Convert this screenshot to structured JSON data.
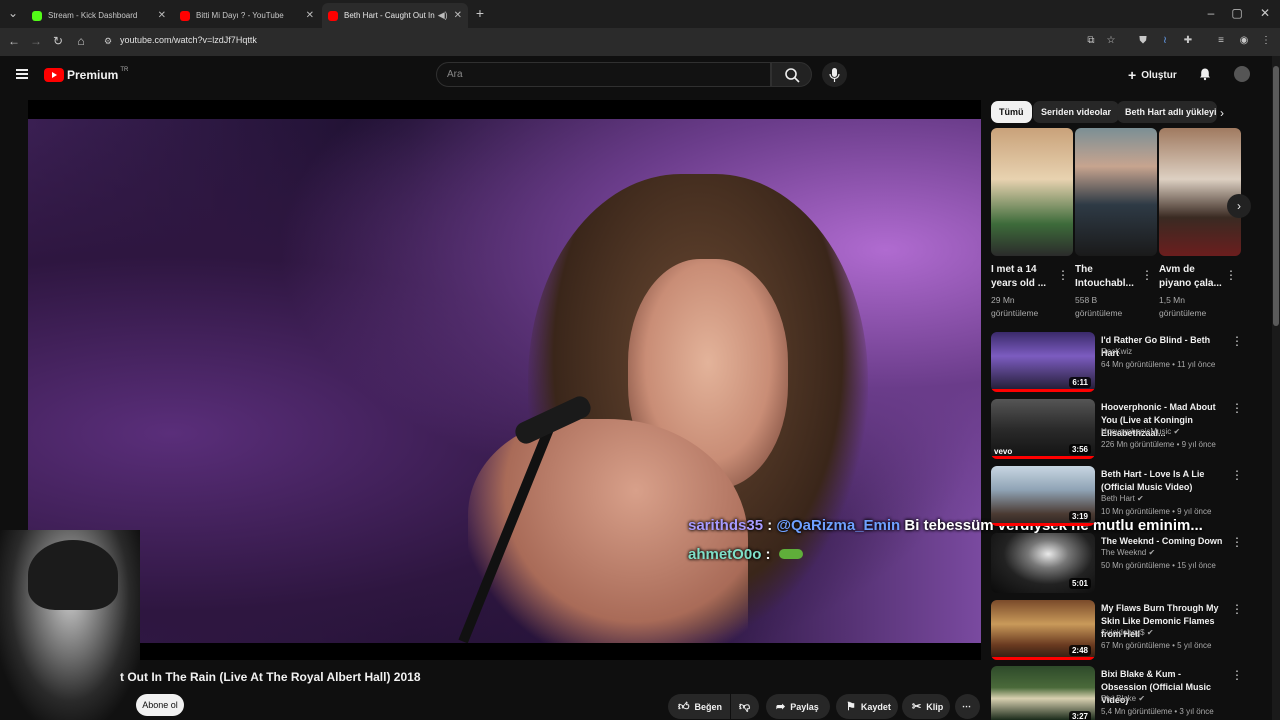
{
  "browser": {
    "tabs": [
      {
        "title": "Stream - Kick Dashboard",
        "favicon_color": "#53fc18"
      },
      {
        "title": "Bitti Mi Dayı ? - YouTube",
        "favicon_color": "#ff0000"
      },
      {
        "title": "Beth Hart - Caught Out In T",
        "favicon_color": "#ff0000"
      }
    ],
    "new_tab": "+",
    "url": "youtube.com/watch?v=lzdJf7Hqttk"
  },
  "header": {
    "logo_text": "Premium",
    "logo_region": "TR",
    "search_placeholder": "Ara",
    "create_label": "Oluştur"
  },
  "video": {
    "title_visible": "t Out In The Rain (Live At The Royal Albert Hall) 2018",
    "subscribe_label": "Abone ol",
    "actions": {
      "like": "Beğen",
      "share": "Paylaş",
      "save": "Kaydet",
      "clip": "Klip"
    }
  },
  "overlay_chat": [
    {
      "user": "sarithds35",
      "sep": " : ",
      "mention": "@QaRizma_Emin",
      "text": " Bi tebessüm verdiysek ne mutlu eminim..."
    },
    {
      "user": "ahmetO0o",
      "sep": " :",
      "text": ""
    }
  ],
  "chips": [
    "Tümü",
    "Seriden videolar",
    "Beth Hart adlı yükleyi"
  ],
  "shorts": [
    {
      "title": "I met a 14 years old ...",
      "views": "29 Mn",
      "views_label": "görüntüleme"
    },
    {
      "title": "The Intouchabl...",
      "views": "558 B",
      "views_label": "görüntüleme"
    },
    {
      "title": "Avm de piyano çala...",
      "views": "1,5 Mn",
      "views_label": "görüntüleme"
    }
  ],
  "recommendations": [
    {
      "title": "I'd Rather Go Blind - Beth Hart",
      "channel": "RocKwiz",
      "verified": false,
      "meta": "64 Mn görüntüleme • 11 yıl önce",
      "duration": "6:11"
    },
    {
      "title": "Hooverphonic - Mad About You (Live at Koningin Elisabethzaal...",
      "channel": "HooverphonicMusic",
      "verified": true,
      "meta": "226 Mn görüntüleme • 9 yıl önce",
      "duration": "3:56"
    },
    {
      "title": "Beth Hart - Love Is A Lie (Official Music Video)",
      "channel": "Beth Hart",
      "verified": true,
      "meta": "10 Mn görüntüleme • 9 yıl önce",
      "duration": "3:19"
    },
    {
      "title": "The Weeknd - Coming Down",
      "channel": "The Weeknd",
      "verified": true,
      "meta": "50 Mn görüntüleme • 15 yıl önce",
      "duration": "5:01"
    },
    {
      "title": "My Flaws Burn Through My Skin Like Demonic Flames from Hell",
      "channel": "Suicideboy$",
      "verified": true,
      "meta": "67 Mn görüntüleme • 5 yıl önce",
      "duration": "2:48"
    },
    {
      "title": "Bixi Blake & Kum - Obsession (Official Music Video)",
      "channel": "Bixi Blake",
      "verified": true,
      "meta": "5,4 Mn görüntüleme • 3 yıl önce",
      "duration": "3:27"
    }
  ],
  "thumb_watermarks": {
    "vevo": "vevo"
  }
}
